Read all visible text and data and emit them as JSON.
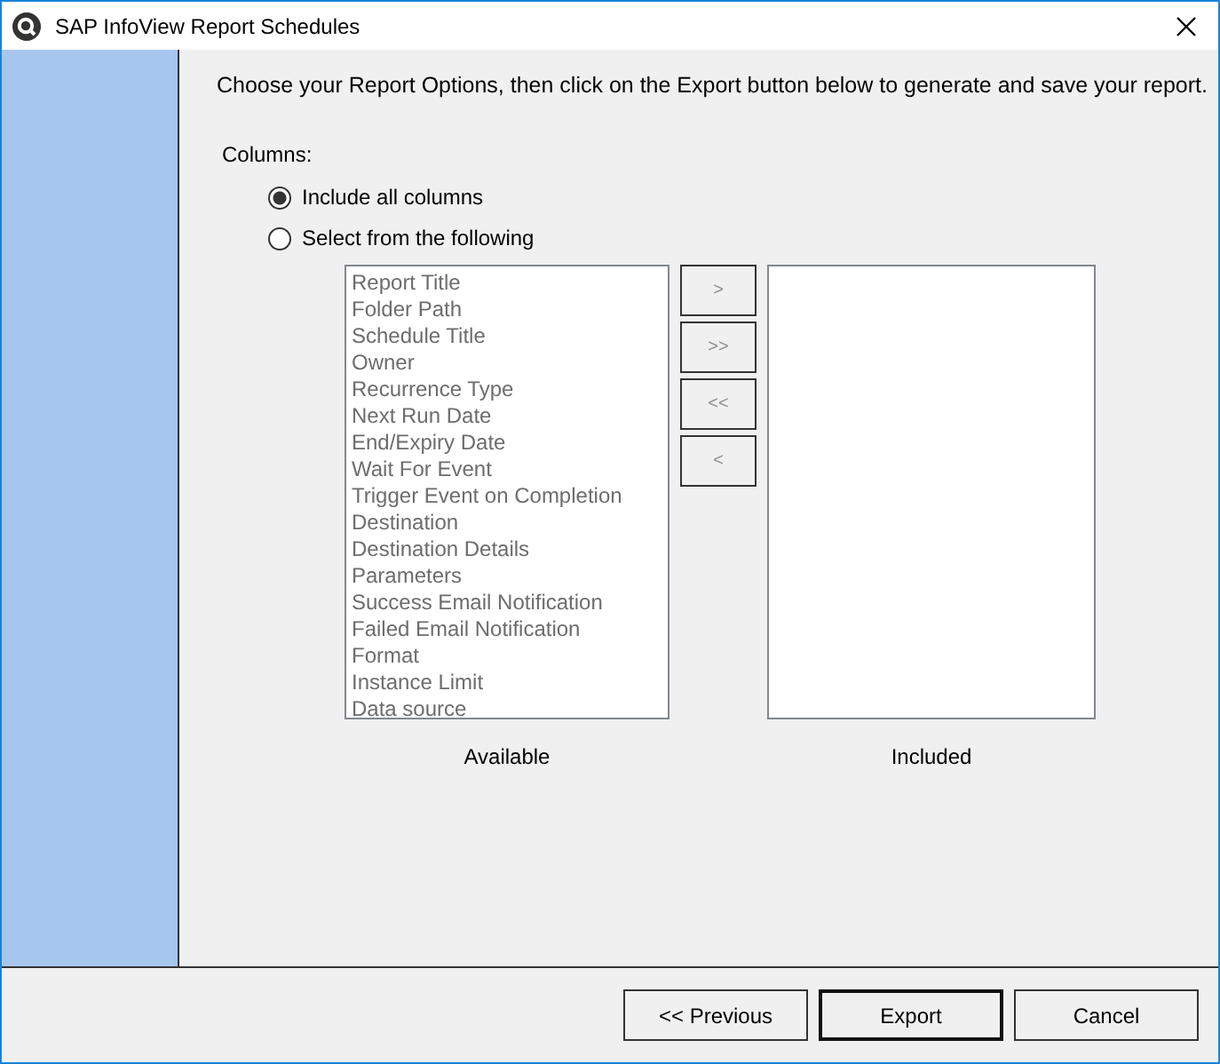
{
  "window": {
    "title": "SAP InfoView Report Schedules"
  },
  "instructions": "Choose your Report Options, then click on the Export button below to generate and save your report.",
  "columns_label": "Columns:",
  "options": [
    {
      "label": "Include all columns",
      "selected": true
    },
    {
      "label": "Select from the following",
      "selected": false
    }
  ],
  "available": {
    "label": "Available",
    "disabled": true,
    "items": [
      "Report Title",
      "Folder Path",
      "Schedule Title",
      "Owner",
      "Recurrence Type",
      "Next Run Date",
      "End/Expiry Date",
      "Wait For Event",
      "Trigger Event on Completion",
      "Destination",
      "Destination Details",
      "Parameters",
      "Success Email Notification",
      "Failed Email Notification",
      "Format",
      "Instance Limit",
      "Data source"
    ]
  },
  "move_buttons": [
    {
      "label": ">",
      "disabled": true
    },
    {
      "label": ">>",
      "disabled": true
    },
    {
      "label": "<<",
      "disabled": true
    },
    {
      "label": "<",
      "disabled": true
    }
  ],
  "included": {
    "label": "Included"
  },
  "buttons": [
    {
      "label": "<< Previous",
      "default": false
    },
    {
      "label": "Export",
      "default": true
    },
    {
      "label": "Cancel",
      "default": false
    }
  ]
}
